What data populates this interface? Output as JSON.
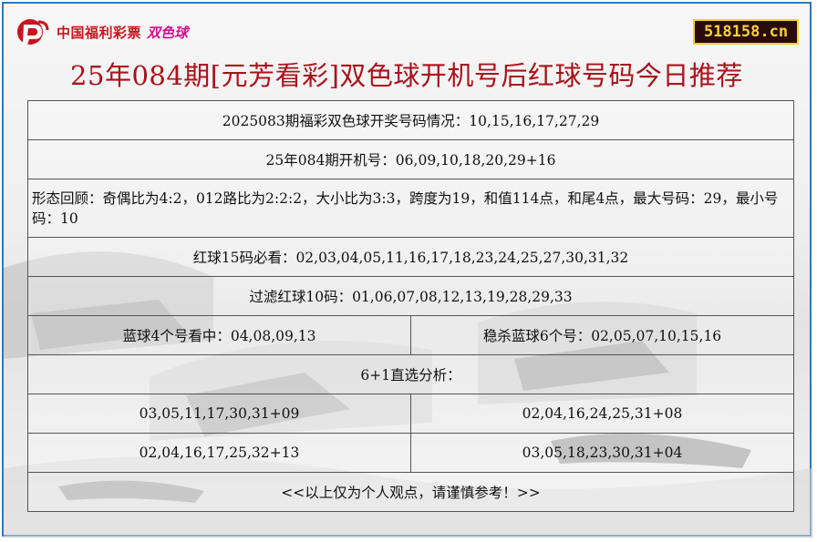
{
  "logo": {
    "brand_text": "中国福利彩票",
    "game_text": "双色球"
  },
  "site": "518158.cn",
  "title": "25年084期[元芳看彩]双色球开机号后红球号码今日推荐",
  "rows": {
    "last_draw": "2025083期福彩双色球开奖号码情况：10,15,16,17,27,29",
    "machine_numbers": "25年084期开机号：06,09,10,18,20,29+16",
    "pattern_review": "形态回顾：奇偶比为4:2，012路比为2:2:2，大小比为3:3，跨度为19，和值114点，和尾4点，最大号码：29，最小号码：10",
    "red_15": "红球15码必看：02,03,04,05,11,16,17,18,23,24,25,27,30,31,32",
    "filter_red_10": "过滤红球10码：01,06,07,08,12,13,19,28,29,33",
    "blue_4": "蓝球4个号看中：04,08,09,13",
    "kill_blue_6": "稳杀蓝球6个号：02,05,07,10,15,16",
    "analysis_header": "6+1直选分析：",
    "picks": [
      "03,05,11,17,30,31+09",
      "02,04,16,24,25,31+08",
      "02,04,16,17,25,32+13",
      "03,05,18,23,30,31+04"
    ],
    "disclaimer": "<<以上仅为个人观点，请谨慎参考！>>"
  },
  "colors": {
    "title": "#a8131b",
    "border": "#2e79b9",
    "badge_bg": "#2a0b0b",
    "badge_text": "#f7d23a",
    "logo_red": "#c8141c",
    "logo_magenta": "#d0118f"
  }
}
